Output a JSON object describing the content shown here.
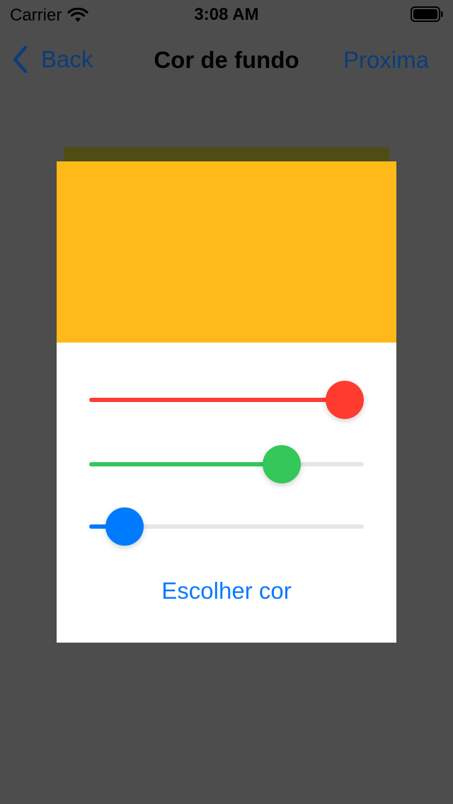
{
  "status_bar": {
    "carrier": "Carrier",
    "time": "3:08 AM",
    "wifi_icon": "wifi-icon",
    "battery_icon": "battery-icon"
  },
  "nav": {
    "back_label": "Back",
    "title": "Cor de fundo",
    "next_label": "Proxima"
  },
  "preview": {
    "color": "#ffb918"
  },
  "sliders": [
    {
      "channel": "red",
      "value_fraction": 1.0,
      "color": "#ff3b30"
    },
    {
      "channel": "green",
      "value_fraction": 0.7,
      "color": "#34c759"
    },
    {
      "channel": "blue",
      "value_fraction": 0.13,
      "color": "#007aff"
    }
  ],
  "choose_button_label": "Escolher cor",
  "colors": {
    "background": "#4d4d4d",
    "accent": "#007aff",
    "nav_tint": "#0a3d7a"
  }
}
